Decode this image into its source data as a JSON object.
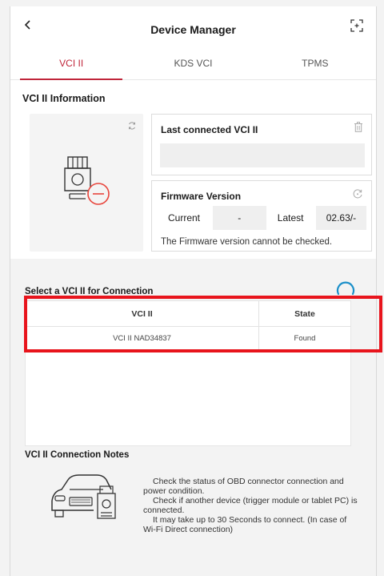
{
  "header": {
    "title": "Device Manager",
    "back_icon": "chevron-left-icon",
    "expand_icon": "fullscreen-icon"
  },
  "tabs": [
    {
      "label": "VCI II",
      "active": true
    },
    {
      "label": "KDS VCI",
      "active": false
    },
    {
      "label": "TPMS",
      "active": false
    }
  ],
  "info": {
    "section_title": "VCI II Information",
    "last_connected": {
      "title": "Last connected VCI II",
      "value": ""
    },
    "firmware": {
      "title": "Firmware Version",
      "current_label": "Current",
      "current_value": "-",
      "latest_label": "Latest",
      "latest_value": "02.63/-",
      "message": "The Firmware version cannot be checked."
    }
  },
  "connection": {
    "section_title": "Select a VCI II for Connection",
    "columns": [
      "VCI II",
      "State"
    ],
    "rows": [
      {
        "vci": "VCI II NAD34837",
        "state": "Found"
      }
    ]
  },
  "notes": {
    "title": "VCI II Connection Notes",
    "lines": [
      "Check the status of OBD connector connection and power condition.",
      "Check if another device (trigger module or tablet PC) is connected.",
      "It may take up to 30 Seconds to connect. (In case of Wi-Fi Direct connection)"
    ]
  },
  "colors": {
    "accent": "#c0253a",
    "highlight": "#e8141c",
    "obd_icon_accent": "#e8453c"
  }
}
